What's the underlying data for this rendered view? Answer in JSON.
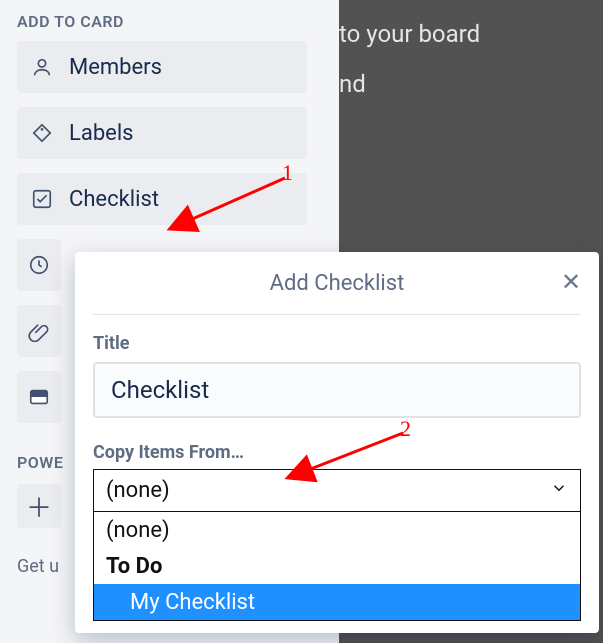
{
  "background": {
    "line1": "to your board",
    "line2": "nd"
  },
  "sidebar": {
    "title": "ADD TO CARD",
    "items": [
      {
        "label": "Members"
      },
      {
        "label": "Labels"
      },
      {
        "label": "Checklist"
      }
    ],
    "powerups_title": "POWE",
    "get_text": "Get u"
  },
  "popover": {
    "title": "Add Checklist",
    "title_label": "Title",
    "title_value": "Checklist",
    "copy_label": "Copy Items From…",
    "selected": "(none)",
    "options": [
      {
        "label": "(none)",
        "type": "none"
      },
      {
        "label": "To Do",
        "type": "card"
      },
      {
        "label": "My Checklist",
        "type": "checklist"
      }
    ]
  },
  "annotations": {
    "one": "1",
    "two": "2"
  }
}
